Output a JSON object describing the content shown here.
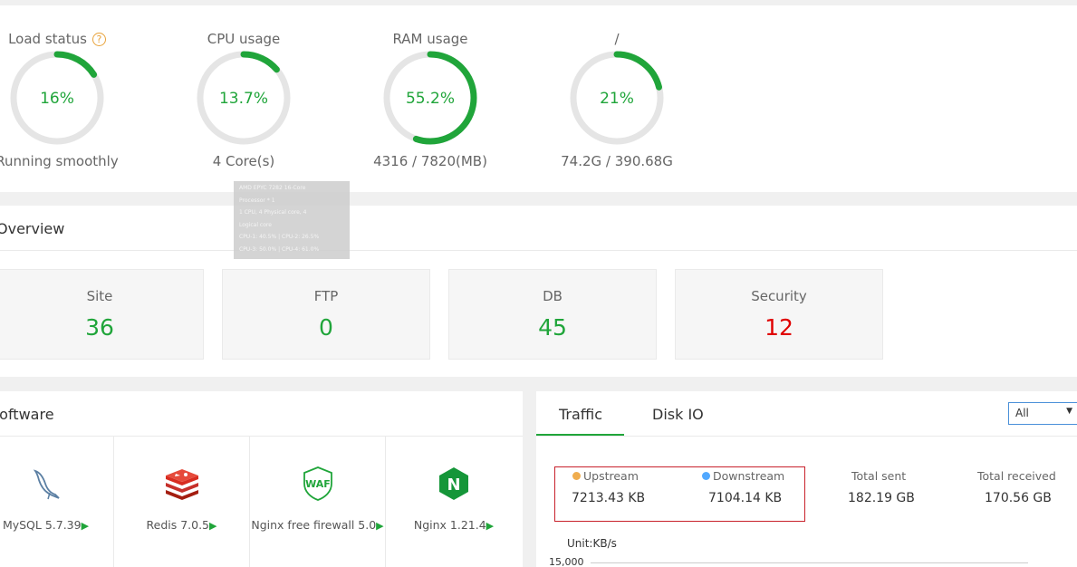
{
  "status": {
    "gauges": [
      {
        "title": "Load status",
        "value": "16%",
        "percent": 16,
        "sub": "Running smoothly",
        "has_help": true
      },
      {
        "title": "CPU usage",
        "value": "13.7%",
        "percent": 13.7,
        "sub": "4 Core(s)"
      },
      {
        "title": "RAM usage",
        "value": "55.2%",
        "percent": 55.2,
        "sub": "4316 / 7820(MB)"
      },
      {
        "title": "/",
        "value": "21%",
        "percent": 21,
        "sub": "74.2G / 390.68G"
      }
    ],
    "help_symbol": "?",
    "colors": {
      "accent": "#20a53a",
      "track": "#e5e5e5",
      "help": "#e8a33b"
    }
  },
  "cpu_tooltip": {
    "lines": [
      "AMD EPYC 7282 16-Core",
      "Processor * 1",
      "1 CPU, 4 Physical core, 4",
      "Logical core",
      "CPU-1: 40.5% | CPU-2: 26.5%",
      "CPU-3: 50.0% | CPU-4: 61.0%"
    ]
  },
  "overview": {
    "title": "Overview",
    "cards": [
      {
        "label": "Site",
        "value": "36"
      },
      {
        "label": "FTP",
        "value": "0"
      },
      {
        "label": "DB",
        "value": "45"
      },
      {
        "label": "Security",
        "value": "12",
        "color": "#e00000"
      }
    ]
  },
  "software": {
    "title": "Software",
    "items": [
      {
        "name": "MySQL 5.7.39",
        "icon": "mysql-dolphin-icon"
      },
      {
        "name": "Redis 7.0.5",
        "icon": "redis-icon"
      },
      {
        "name": "Nginx free firewall 5.0",
        "icon": "waf-shield-icon",
        "icon_text": "WAF"
      },
      {
        "name": "Nginx 1.21.4",
        "icon": "nginx-icon",
        "icon_text": "N"
      }
    ],
    "play_glyph": "▶"
  },
  "traffic": {
    "tabs": [
      "Traffic",
      "Disk IO"
    ],
    "select": {
      "value": "All",
      "arrow": "▼"
    },
    "upstream": {
      "label": "Upstream",
      "value": "7213.43 KB",
      "color": "#f0ad4e"
    },
    "downstream": {
      "label": "Downstream",
      "value": "7104.14 KB",
      "color": "#52a9ff"
    },
    "total_sent": {
      "label": "Total sent",
      "value": "182.19 GB"
    },
    "total_received": {
      "label": "Total received",
      "value": "170.56 GB"
    },
    "unit": "Unit:KB/s",
    "tick_top": "15,000"
  }
}
